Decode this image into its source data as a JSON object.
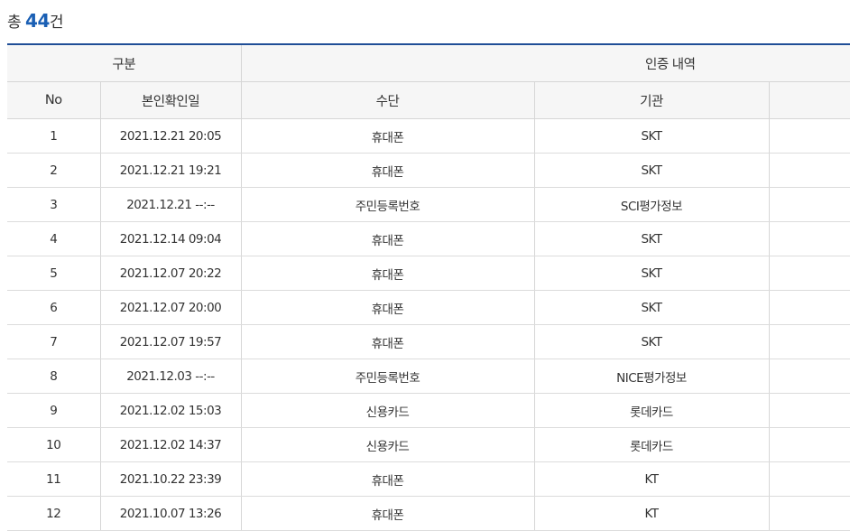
{
  "summary": {
    "prefix": "총",
    "count": "44",
    "suffix": "건"
  },
  "table": {
    "group_headers": {
      "category": "구분",
      "auth_history": "인증 내역"
    },
    "columns": {
      "no": "No",
      "date": "본인확인일",
      "method": "수단",
      "agency": "기관"
    },
    "rows": [
      {
        "no": "1",
        "date": "2021.12.21 20:05",
        "method": "휴대폰",
        "agency": "SKT"
      },
      {
        "no": "2",
        "date": "2021.12.21 19:21",
        "method": "휴대폰",
        "agency": "SKT"
      },
      {
        "no": "3",
        "date": "2021.12.21 --:--",
        "method": "주민등록번호",
        "agency": "SCI평가정보"
      },
      {
        "no": "4",
        "date": "2021.12.14 09:04",
        "method": "휴대폰",
        "agency": "SKT"
      },
      {
        "no": "5",
        "date": "2021.12.07 20:22",
        "method": "휴대폰",
        "agency": "SKT"
      },
      {
        "no": "6",
        "date": "2021.12.07 20:00",
        "method": "휴대폰",
        "agency": "SKT"
      },
      {
        "no": "7",
        "date": "2021.12.07 19:57",
        "method": "휴대폰",
        "agency": "SKT"
      },
      {
        "no": "8",
        "date": "2021.12.03 --:--",
        "method": "주민등록번호",
        "agency": "NICE평가정보"
      },
      {
        "no": "9",
        "date": "2021.12.02 15:03",
        "method": "신용카드",
        "agency": "롯데카드"
      },
      {
        "no": "10",
        "date": "2021.12.02 14:37",
        "method": "신용카드",
        "agency": "롯데카드"
      },
      {
        "no": "11",
        "date": "2021.10.22 23:39",
        "method": "휴대폰",
        "agency": "KT"
      },
      {
        "no": "12",
        "date": "2021.10.07 13:26",
        "method": "휴대폰",
        "agency": "KT"
      }
    ]
  },
  "colors": {
    "accent": "#1a5fb4",
    "header_rule": "#1f4e96",
    "header_bg": "#f6f6f6",
    "grid": "#d6d6d6"
  }
}
